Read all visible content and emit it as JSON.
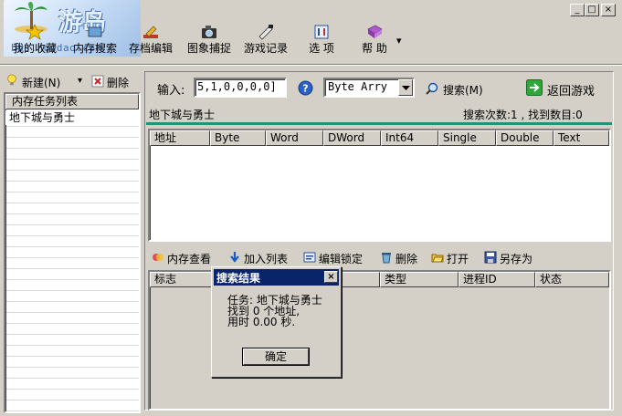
{
  "window": {
    "brand": "游岛",
    "site": "bbs.houdao.com",
    "min_glyph": "_",
    "max_glyph": "□",
    "close_glyph": "×"
  },
  "toolbar": {
    "favorites": "我的收藏",
    "memory_search": "内存搜索",
    "save_edit": "存档编辑",
    "screen_capture": "图象捕捉",
    "game_record": "游戏记录",
    "options": "选 项",
    "help": "帮 助",
    "help_arrow": "▾"
  },
  "sidebar": {
    "new_label": "新建(N)",
    "new_arrow": "▾",
    "delete_label": "删除",
    "header": "内存任务列表",
    "items": [
      "地下城与勇士"
    ]
  },
  "search": {
    "input_label": "输入:",
    "input_value": "5,1,0,0,0,0]",
    "help_glyph": "?",
    "type_value": "Byte Arry",
    "search_button": "搜索(M)",
    "return_button": "返回游戏",
    "process_name": "地下城与勇士",
    "status": "搜索次数:1 , 找到数目:0"
  },
  "results_table": {
    "columns": [
      "地址",
      "Byte",
      "Word",
      "DWord",
      "Int64",
      "Single",
      "Double",
      "Text"
    ]
  },
  "lower_toolbar": {
    "view_memory": "内存查看",
    "add_list": "加入列表",
    "edit_lock": "编辑锁定",
    "delete": "删除",
    "open": "打开",
    "save_as": "另存为"
  },
  "lock_table": {
    "columns": [
      "标志",
      "",
      "类型",
      "进程ID",
      "状态"
    ]
  },
  "dialog": {
    "title": "搜索结果",
    "close_glyph": "×",
    "line1": "任务: 地下城与勇士",
    "line2": "找到 0 个地址,",
    "line3": "用时 0.00 秒.",
    "ok_button": "确定"
  }
}
